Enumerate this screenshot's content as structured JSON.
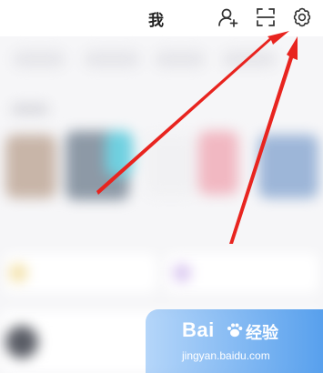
{
  "header": {
    "title": "我",
    "icons": [
      "add-friend-icon",
      "scan-icon",
      "settings-icon"
    ]
  },
  "watermark": {
    "brand": "Bai",
    "brand_suffix": "经验",
    "url": "jingyan.baidu.com"
  },
  "colors": {
    "annotation_arrow": "#e8241f",
    "watermark_blue": "#4a96ea"
  }
}
